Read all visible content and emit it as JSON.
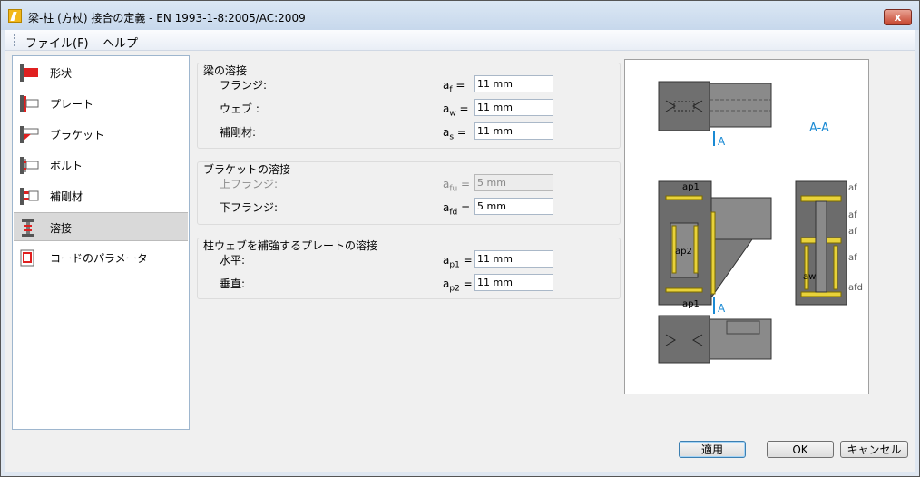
{
  "window": {
    "title": "梁-柱 (方杖) 接合の定義 - EN 1993-1-8:2005/AC:2009",
    "close_label": "x"
  },
  "menu": {
    "file": "ファイル(F)",
    "help": "ヘルプ"
  },
  "nav": {
    "items": [
      {
        "label": "形状"
      },
      {
        "label": "プレート"
      },
      {
        "label": "ブラケット"
      },
      {
        "label": "ボルト"
      },
      {
        "label": "補剛材"
      },
      {
        "label": "溶接"
      },
      {
        "label": "コードのパラメータ"
      }
    ],
    "selected_index": 5
  },
  "beam_weld": {
    "title": "梁の溶接",
    "rows": [
      {
        "label": "フランジ:",
        "symbol": "a",
        "sub": "f",
        "value": "11 mm"
      },
      {
        "label": "ウェブ :",
        "symbol": "a",
        "sub": "w",
        "value": "11 mm"
      },
      {
        "label": "補剛材:",
        "symbol": "a",
        "sub": "s",
        "value": "11 mm"
      }
    ]
  },
  "bracket_weld": {
    "title": "ブラケットの溶接",
    "rows": [
      {
        "label": "上フランジ:",
        "symbol": "a",
        "sub": "fu",
        "value": "5 mm",
        "disabled": true
      },
      {
        "label": "下フランジ:",
        "symbol": "a",
        "sub": "fd",
        "value": "5 mm",
        "disabled": false
      }
    ]
  },
  "web_plate_weld": {
    "title": "柱ウェブを補強するプレートの溶接",
    "rows": [
      {
        "label": "水平:",
        "symbol": "a",
        "sub": "p1",
        "value": "11 mm"
      },
      {
        "label": "垂直:",
        "symbol": "a",
        "sub": "p2",
        "value": "11 mm"
      }
    ]
  },
  "preview": {
    "section_label": "A-A",
    "cut_mark": "A",
    "labels": {
      "ap1": "ap1",
      "ap2": "ap2",
      "aw": "aw",
      "af": "af",
      "afd": "afd"
    },
    "colors": {
      "steel": "#7b7b7b",
      "weld": "#e8d23a",
      "accent": "#1a8ad4"
    }
  },
  "buttons": {
    "apply": "適用",
    "ok": "OK",
    "cancel": "キャンセル"
  }
}
